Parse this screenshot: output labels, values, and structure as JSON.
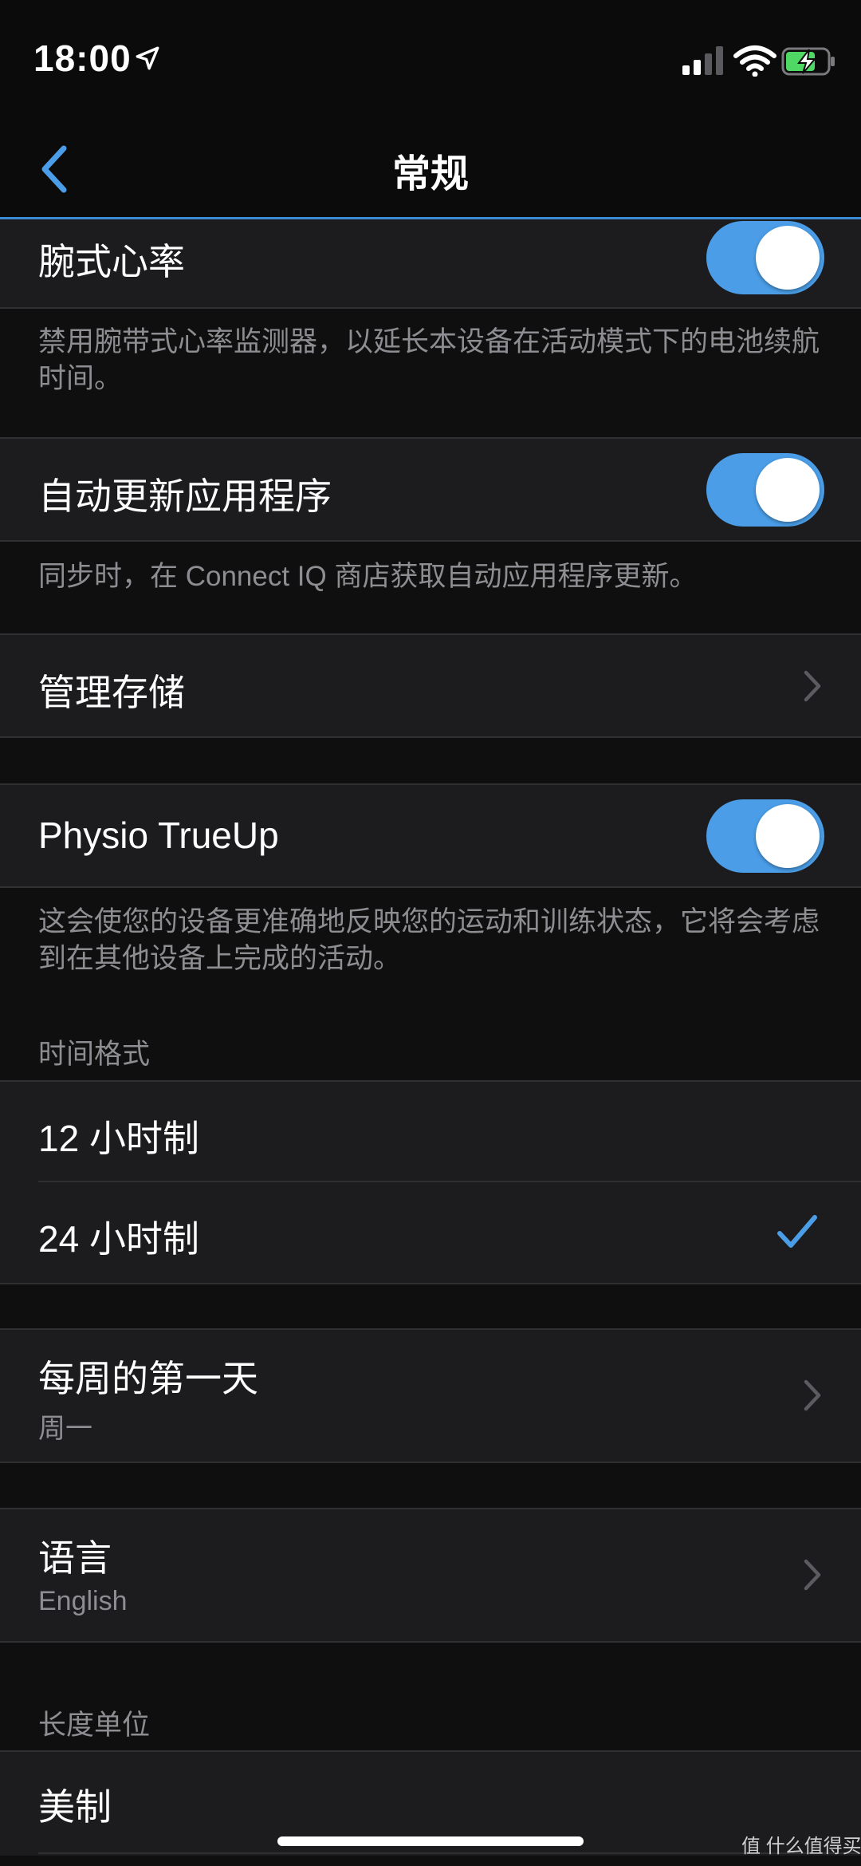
{
  "status_bar": {
    "time": "18:00",
    "icons": [
      "location-arrow-icon",
      "cellular-signal-icon",
      "wifi-icon",
      "battery-charging-icon"
    ]
  },
  "nav": {
    "title": "常规",
    "back_icon": "chevron-left-icon"
  },
  "settings": {
    "wrist_hr": {
      "label": "腕式心率",
      "enabled": true,
      "description": "禁用腕带式心率监测器，以延长本设备在活动模式下的电池续航时间。"
    },
    "auto_update": {
      "label": "自动更新应用程序",
      "enabled": true,
      "description": "同步时，在 Connect IQ 商店获取自动应用程序更新。"
    },
    "manage_storage": {
      "label": "管理存储"
    },
    "physio_trueup": {
      "label": "Physio TrueUp",
      "enabled": true,
      "description": "这会使您的设备更准确地反映您的运动和训练状态，它将会考虑到在其他设备上完成的活动。"
    },
    "time_format": {
      "header": "时间格式",
      "options": [
        {
          "label": "12 小时制",
          "selected": false
        },
        {
          "label": "24 小时制",
          "selected": true
        }
      ]
    },
    "first_day_of_week": {
      "label": "每周的第一天",
      "value": "周一"
    },
    "language": {
      "label": "语言",
      "value": "English"
    },
    "length_unit": {
      "header": "长度单位",
      "selected": "美制"
    }
  },
  "colors": {
    "accent": "#4a9de6",
    "background": "#0f0f0f",
    "cell": "#1c1c1e",
    "secondary_text": "#8d8d92"
  },
  "watermark": "值 什么值得买"
}
